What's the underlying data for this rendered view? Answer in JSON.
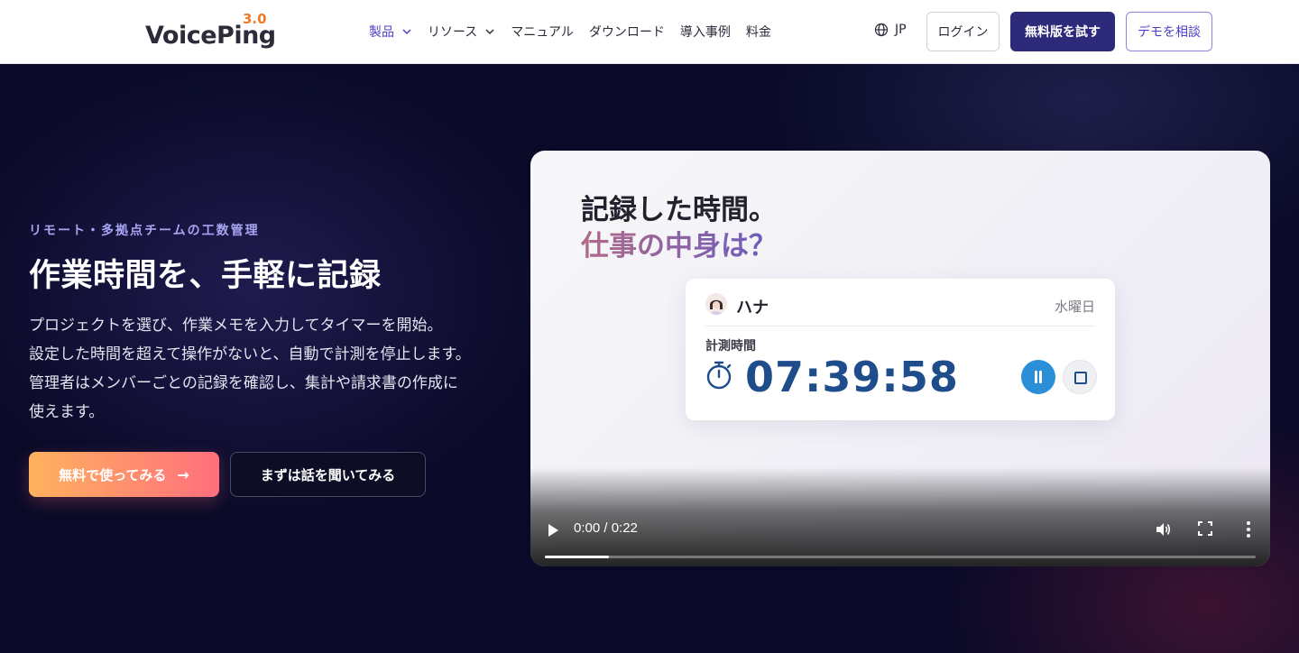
{
  "header": {
    "logo": {
      "text": "VoicePing",
      "version": "3.0"
    },
    "nav": [
      {
        "label": "製品",
        "dropdown": true,
        "active": true
      },
      {
        "label": "リソース",
        "dropdown": true,
        "active": false
      },
      {
        "label": "マニュアル",
        "dropdown": false,
        "active": false
      },
      {
        "label": "ダウンロード",
        "dropdown": false,
        "active": false
      },
      {
        "label": "導入事例",
        "dropdown": false,
        "active": false
      },
      {
        "label": "料金",
        "dropdown": false,
        "active": false
      }
    ],
    "language": "JP",
    "login_label": "ログイン",
    "trial_label": "無料版を試す",
    "demo_label": "デモを相談"
  },
  "hero": {
    "eyebrow": "リモート・多拠点チームの工数管理",
    "headline": "作業時間を、手軽に記録",
    "description_lines": [
      "プロジェクトを選び、作業メモを入力してタイマーを開始。",
      "設定した時間を超えて操作がないと、自動で計測を停止します。",
      "管理者はメンバーごとの記録を確認し、集計や請求書の作成に",
      "使えます。"
    ],
    "cta_primary": "無料で使ってみる",
    "cta_secondary": "まずは話を聞いてみる"
  },
  "video": {
    "title_line1": "記録した時間。",
    "title_line2": "仕事の中身は？",
    "card": {
      "name": "ハナ",
      "day": "水曜日",
      "label": "計測時間",
      "timer": "07:39:58"
    },
    "player": {
      "time": "0:00 / 0:22",
      "progress_fraction": 0.09
    }
  },
  "colors": {
    "accent": "#4b3fc7",
    "trial_button": "#2e2a7a",
    "cta_gradient_start": "#ffb25e",
    "cta_gradient_end": "#ff6f7d",
    "timer_text": "#1f4c8a",
    "pause_button": "#2a8fd6"
  }
}
